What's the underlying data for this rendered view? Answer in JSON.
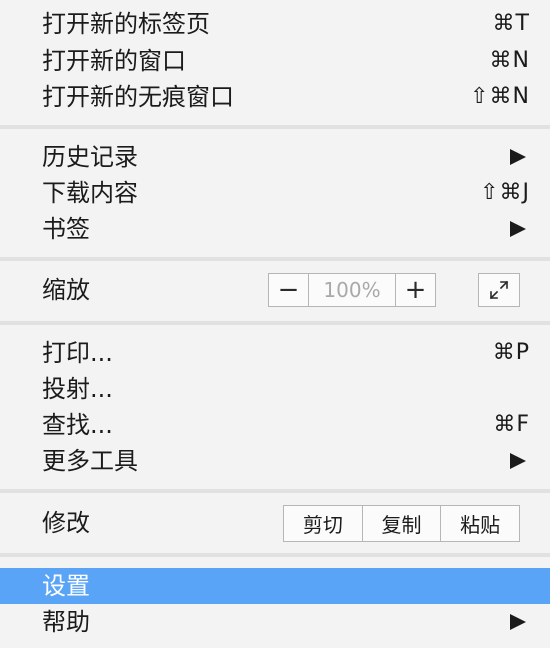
{
  "menu": {
    "new_tab": {
      "label": "打开新的标签页",
      "shortcut": "⌘T"
    },
    "new_window": {
      "label": "打开新的窗口",
      "shortcut": "⌘N"
    },
    "new_incognito": {
      "label": "打开新的无痕窗口",
      "shortcut": "⇧⌘N"
    },
    "history": {
      "label": "历史记录"
    },
    "downloads": {
      "label": "下载内容",
      "shortcut": "⇧⌘J"
    },
    "bookmarks": {
      "label": "书签"
    },
    "zoom": {
      "label": "缩放",
      "minus": "−",
      "value": "100%",
      "plus": "+"
    },
    "print": {
      "label": "打印...",
      "shortcut": "⌘P"
    },
    "cast": {
      "label": "投射..."
    },
    "find": {
      "label": "查找...",
      "shortcut": "⌘F"
    },
    "more_tools": {
      "label": "更多工具"
    },
    "edit": {
      "label": "修改",
      "cut": "剪切",
      "copy": "复制",
      "paste": "粘贴"
    },
    "settings": {
      "label": "设置"
    },
    "help": {
      "label": "帮助"
    }
  },
  "colors": {
    "highlight": "#59a4f7",
    "background": "#f3f3f3",
    "divider": "#e1e1e1"
  },
  "icons": {
    "submenu": "submenu-arrow-icon",
    "fullscreen": "fullscreen-icon"
  }
}
